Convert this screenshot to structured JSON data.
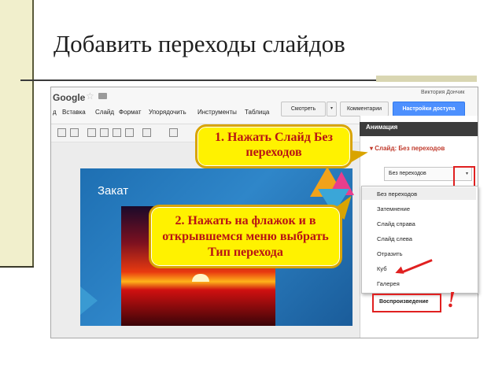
{
  "slide": {
    "title": "Добавить переходы слайдов"
  },
  "app": {
    "logo": "Google",
    "account": "Виктория Дончик",
    "menu": [
      "д",
      "Вставка",
      "Слайд",
      "Формат",
      "Упорядочить",
      "Инструменты",
      "Таблица"
    ],
    "buttons": {
      "show": "Смотреть",
      "comments": "Комментарии",
      "share": "Настройки доступа"
    }
  },
  "canvas": {
    "slide_title": "Закат"
  },
  "panel": {
    "header": "Анимация",
    "slide_label": "▾ Слайд: Без переходов",
    "selected_value": "Без переходов",
    "options": [
      "Без переходов",
      "Затемнение",
      "Слайд справа",
      "Слайд слева",
      "Отразить",
      "Куб",
      "Галерея"
    ],
    "play_label": "Воспроизведение",
    "exclamation": "!"
  },
  "callouts": {
    "step1": "1. Нажать Слайд Без переходов",
    "step2": "2. Нажать на флажок и в открывшемся меню выбрать Тип перехода"
  },
  "colors": {
    "accent_red": "#e02020",
    "callout_fill": "#fff200",
    "callout_text": "#b81414",
    "share_button": "#4d90fe"
  }
}
